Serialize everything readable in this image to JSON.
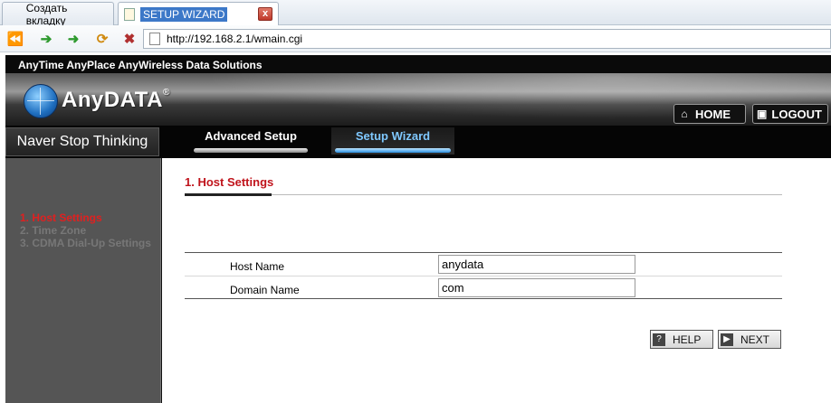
{
  "browser": {
    "tabs": [
      {
        "label": "Создать вкладку"
      },
      {
        "label": "SETUP WIZARD"
      }
    ],
    "close_glyph": "x",
    "url": "http://192.168.2.1/wmain.cgi"
  },
  "header": {
    "tagline": "AnyTime AnyPlace AnyWireless Data Solutions",
    "logo_text": "AnyDATA",
    "logo_mark": "®",
    "home_label": "HOME",
    "logout_label": "LOGOUT"
  },
  "menu": {
    "slogan": "Naver Stop Thinking",
    "tabs": [
      {
        "label": "Advanced Setup"
      },
      {
        "label": "Setup Wizard"
      }
    ]
  },
  "sidebar": {
    "items": [
      {
        "label": "1. Host Settings",
        "active": true
      },
      {
        "label": "2. Time Zone",
        "active": false
      },
      {
        "label": "3. CDMA Dial-Up Settings",
        "active": false
      }
    ]
  },
  "main": {
    "section_title": "1. Host Settings",
    "fields": [
      {
        "label": "Host Name",
        "value": "anydata"
      },
      {
        "label": "Domain Name",
        "value": "com"
      }
    ],
    "help_label": "HELP",
    "next_label": "NEXT"
  },
  "colors": {
    "accent_red": "#c0141c",
    "active_tab_blue": "#2a8fe0"
  }
}
